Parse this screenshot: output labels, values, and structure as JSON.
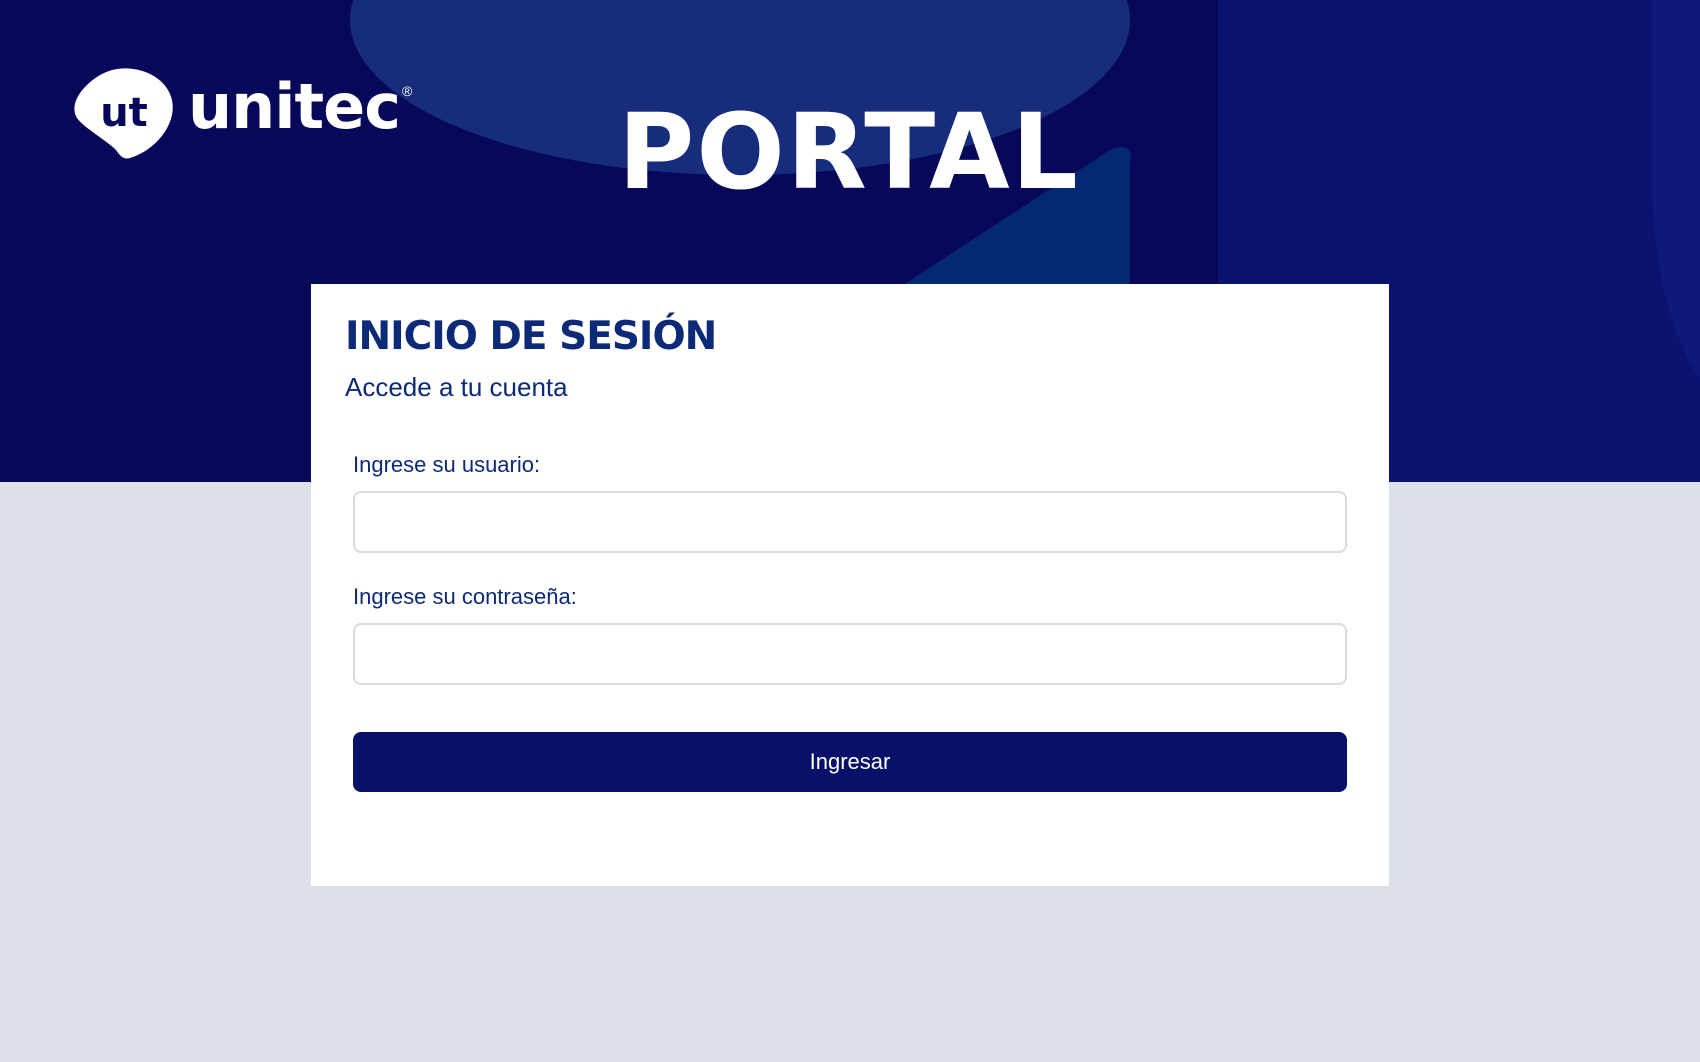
{
  "brand": {
    "logo_text": "unitec",
    "logo_mark_text": "ut",
    "registered_mark": "®"
  },
  "header": {
    "title": "PORTAL"
  },
  "login": {
    "title": "INICIO DE SESIÓN",
    "subtitle": "Accede a tu cuenta",
    "username_label": "Ingrese su usuario:",
    "username_value": "",
    "password_label": "Ingrese su contraseña:",
    "password_value": "",
    "submit_label": "Ingresar"
  },
  "colors": {
    "hero_background": "#07085a",
    "page_background": "#dce0e7",
    "accent_text": "#0d2a78",
    "button_background": "#08106a",
    "card_background": "#ffffff"
  }
}
